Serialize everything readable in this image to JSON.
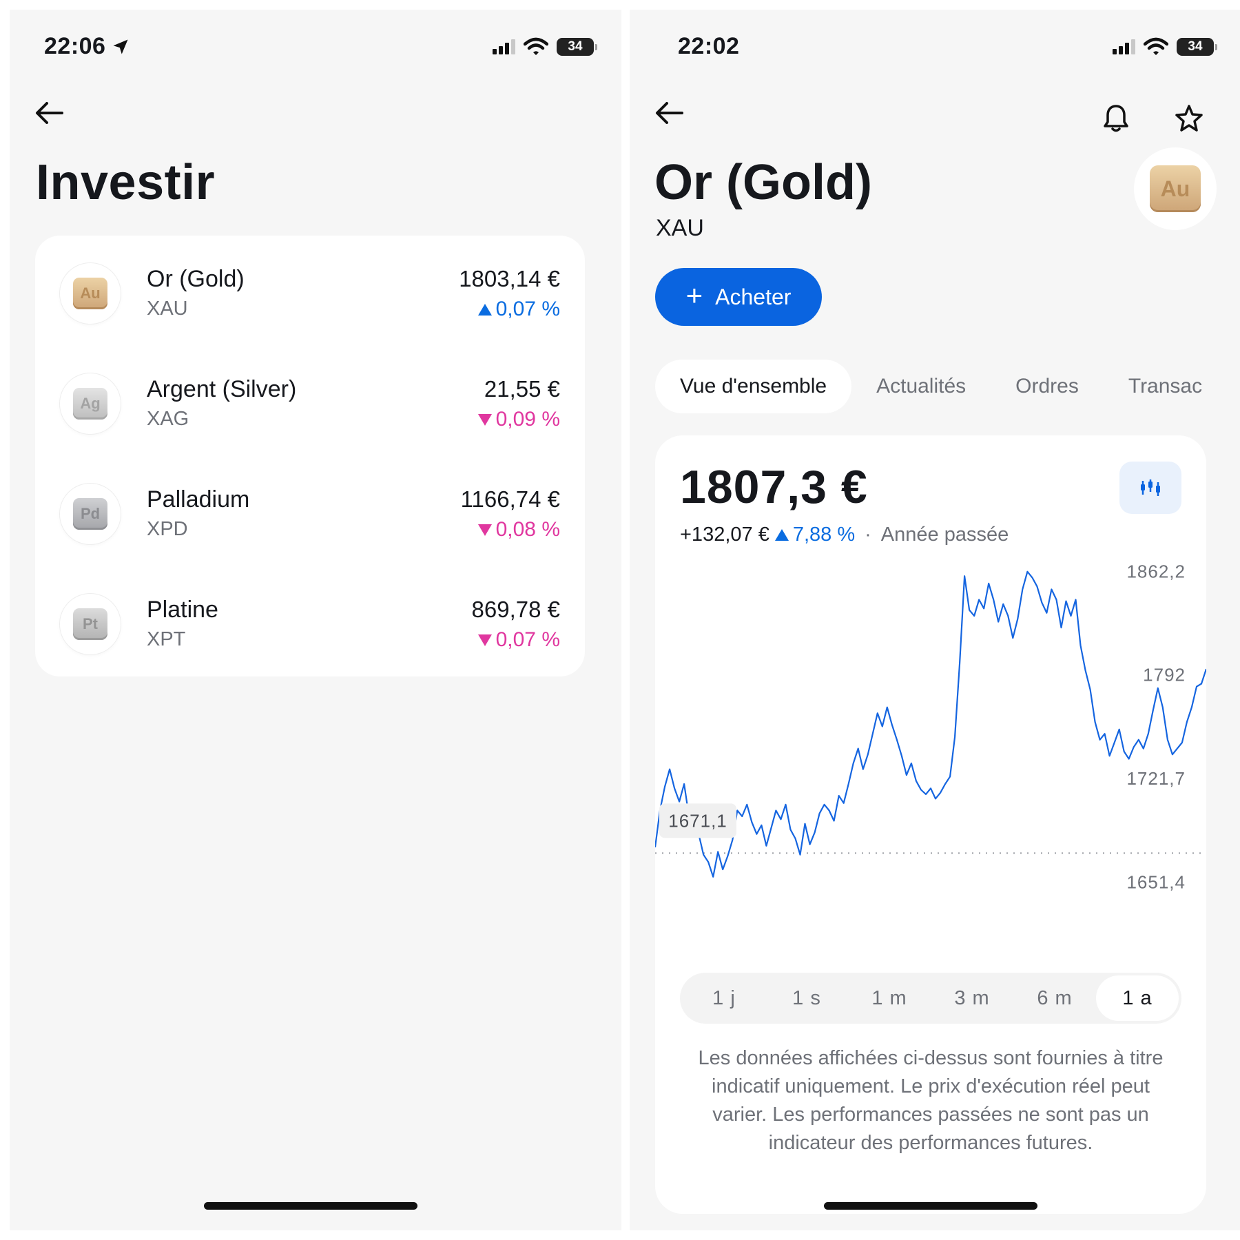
{
  "left": {
    "status": {
      "time": "22:06",
      "battery": "34"
    },
    "title": "Investir",
    "assets": [
      {
        "logo": "Au",
        "name": "Or (Gold)",
        "ticker": "XAU",
        "price": "1803,14 €",
        "change": "0,07 %",
        "direction": "up"
      },
      {
        "logo": "Ag",
        "name": "Argent (Silver)",
        "ticker": "XAG",
        "price": "21,55 €",
        "change": "0,09 %",
        "direction": "down"
      },
      {
        "logo": "Pd",
        "name": "Palladium",
        "ticker": "XPD",
        "price": "1166,74 €",
        "change": "0,08 %",
        "direction": "down"
      },
      {
        "logo": "Pt",
        "name": "Platine",
        "ticker": "XPT",
        "price": "869,78 €",
        "change": "0,07 %",
        "direction": "down"
      }
    ]
  },
  "right": {
    "status": {
      "time": "22:02",
      "battery": "34"
    },
    "title": "Or (Gold)",
    "ticker": "XAU",
    "logo": "Au",
    "buy_label": "Acheter",
    "tabs": [
      "Vue d'ensemble",
      "Actualités",
      "Ordres",
      "Transac"
    ],
    "price": "1807,3 €",
    "change_abs": "+132,07 €",
    "change_pct": "7,88 %",
    "change_period": "Année passée",
    "ranges": [
      "1 j",
      "1 s",
      "1 m",
      "3 m",
      "6 m",
      "1 a"
    ],
    "active_range": "1 a",
    "disclaimer": "Les données affichées ci-dessus sont fournies à titre indicatif uniquement. Le prix d'exécution réel peut varier. Les performances passées ne sont pas un indicateur des performances futures."
  },
  "colors": {
    "accent": "#0a64e0",
    "line": "#1565e0",
    "up": "#0a6ce0",
    "down": "#e0379f"
  },
  "icons": [
    "back-arrow-icon",
    "location-arrow-icon",
    "signal-icon",
    "wifi-icon",
    "battery-icon",
    "bell-icon",
    "star-icon",
    "plus-icon",
    "candlestick-icon",
    "triangle-up-icon",
    "triangle-down-icon"
  ],
  "chart_data": {
    "type": "line",
    "title": "",
    "xlabel": "",
    "ylabel": "",
    "y_tick_labels": [
      "1862,2",
      "1792",
      "1721,7",
      "1651,4"
    ],
    "y_ticks": [
      1862.2,
      1792,
      1721.7,
      1651.4
    ],
    "ylim": [
      1632,
      1875
    ],
    "reference_label": "1671,1",
    "reference_value": 1671.1,
    "grid": false,
    "values": [
      1675,
      1700,
      1716,
      1728,
      1715,
      1706,
      1718,
      1696,
      1692,
      1684,
      1670,
      1665,
      1655,
      1672,
      1660,
      1669,
      1680,
      1700,
      1696,
      1704,
      1692,
      1684,
      1690,
      1676,
      1688,
      1700,
      1694,
      1704,
      1687,
      1681,
      1670,
      1691,
      1677,
      1685,
      1698,
      1704,
      1700,
      1693,
      1710,
      1705,
      1718,
      1732,
      1742,
      1728,
      1738,
      1752,
      1766,
      1757,
      1770,
      1758,
      1748,
      1737,
      1724,
      1732,
      1720,
      1714,
      1711,
      1715,
      1708,
      1712,
      1718,
      1723,
      1750,
      1800,
      1859,
      1836,
      1832,
      1843,
      1837,
      1854,
      1843,
      1828,
      1840,
      1832,
      1817,
      1830,
      1850,
      1862,
      1858,
      1852,
      1841,
      1834,
      1850,
      1843,
      1824,
      1842,
      1832,
      1843,
      1812,
      1795,
      1782,
      1760,
      1748,
      1752,
      1737,
      1746,
      1755,
      1740,
      1735,
      1743,
      1748,
      1742,
      1752,
      1768,
      1783,
      1770,
      1748,
      1738,
      1742,
      1746,
      1760,
      1770,
      1784,
      1786,
      1796
    ]
  }
}
